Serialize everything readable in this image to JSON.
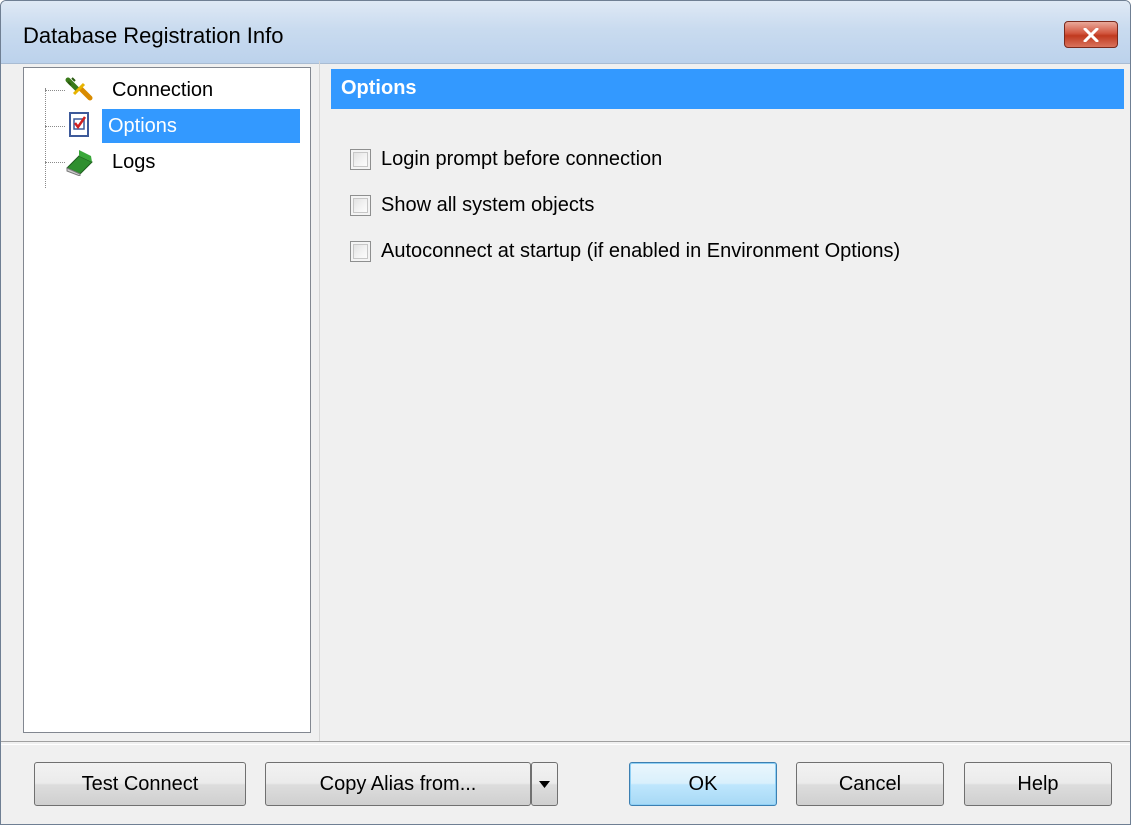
{
  "window": {
    "title": "Database Registration Info"
  },
  "tree": {
    "items": [
      {
        "label": "Connection",
        "icon": "connection-plug-icon",
        "selected": false
      },
      {
        "label": "Options",
        "icon": "options-checklist-icon",
        "selected": true
      },
      {
        "label": "Logs",
        "icon": "logs-book-icon",
        "selected": false
      }
    ]
  },
  "options_page": {
    "header": "Options",
    "checkboxes": [
      {
        "label": "Login prompt before connection",
        "checked": false
      },
      {
        "label": "Show all system objects",
        "checked": false
      },
      {
        "label": "Autoconnect at startup (if enabled in Environment Options)",
        "checked": false
      }
    ]
  },
  "buttons": {
    "test_connect": "Test Connect",
    "copy_alias": "Copy Alias from...",
    "ok": "OK",
    "cancel": "Cancel",
    "help": "Help"
  },
  "colors": {
    "selection": "#3399ff",
    "header": "#3399ff",
    "close_button": "#c0391f"
  }
}
